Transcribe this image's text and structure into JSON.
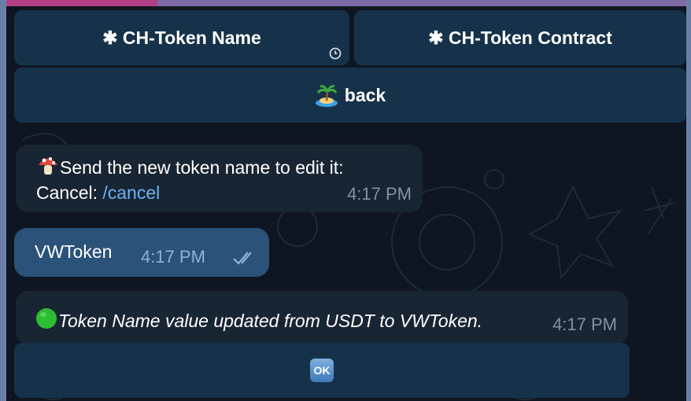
{
  "keyboard_top": {
    "buttons": [
      {
        "label": "✱ CH-Token Name"
      },
      {
        "label": "✱ CH-Token Contract"
      },
      {
        "label": "back",
        "icon": "island-emoji-icon"
      }
    ]
  },
  "messages": [
    {
      "id": "m1",
      "direction": "in",
      "line1": "Send the new token name to edit it:",
      "cancel_prefix": "Cancel: ",
      "cancel_link": "/cancel",
      "time": "4:17 PM",
      "icon": "mushroom-emoji-icon"
    },
    {
      "id": "m2",
      "direction": "out",
      "text": "VWToken",
      "time": "4:17 PM",
      "status": "read-double-check-icon"
    },
    {
      "id": "m3",
      "direction": "in",
      "text": "Token Name value updated from USDT to VWToken.",
      "time": "4:17 PM",
      "icon": "green-circle-emoji-icon"
    }
  ],
  "keyboard_bottom": {
    "buttons": [
      {
        "label": "OK",
        "icon": "ok-emoji-icon"
      }
    ]
  },
  "colors": {
    "bg": "#0e1621",
    "incoming": "#182533",
    "outgoing": "#2b5278",
    "button": "#16324a",
    "link": "#6ab3f3"
  }
}
